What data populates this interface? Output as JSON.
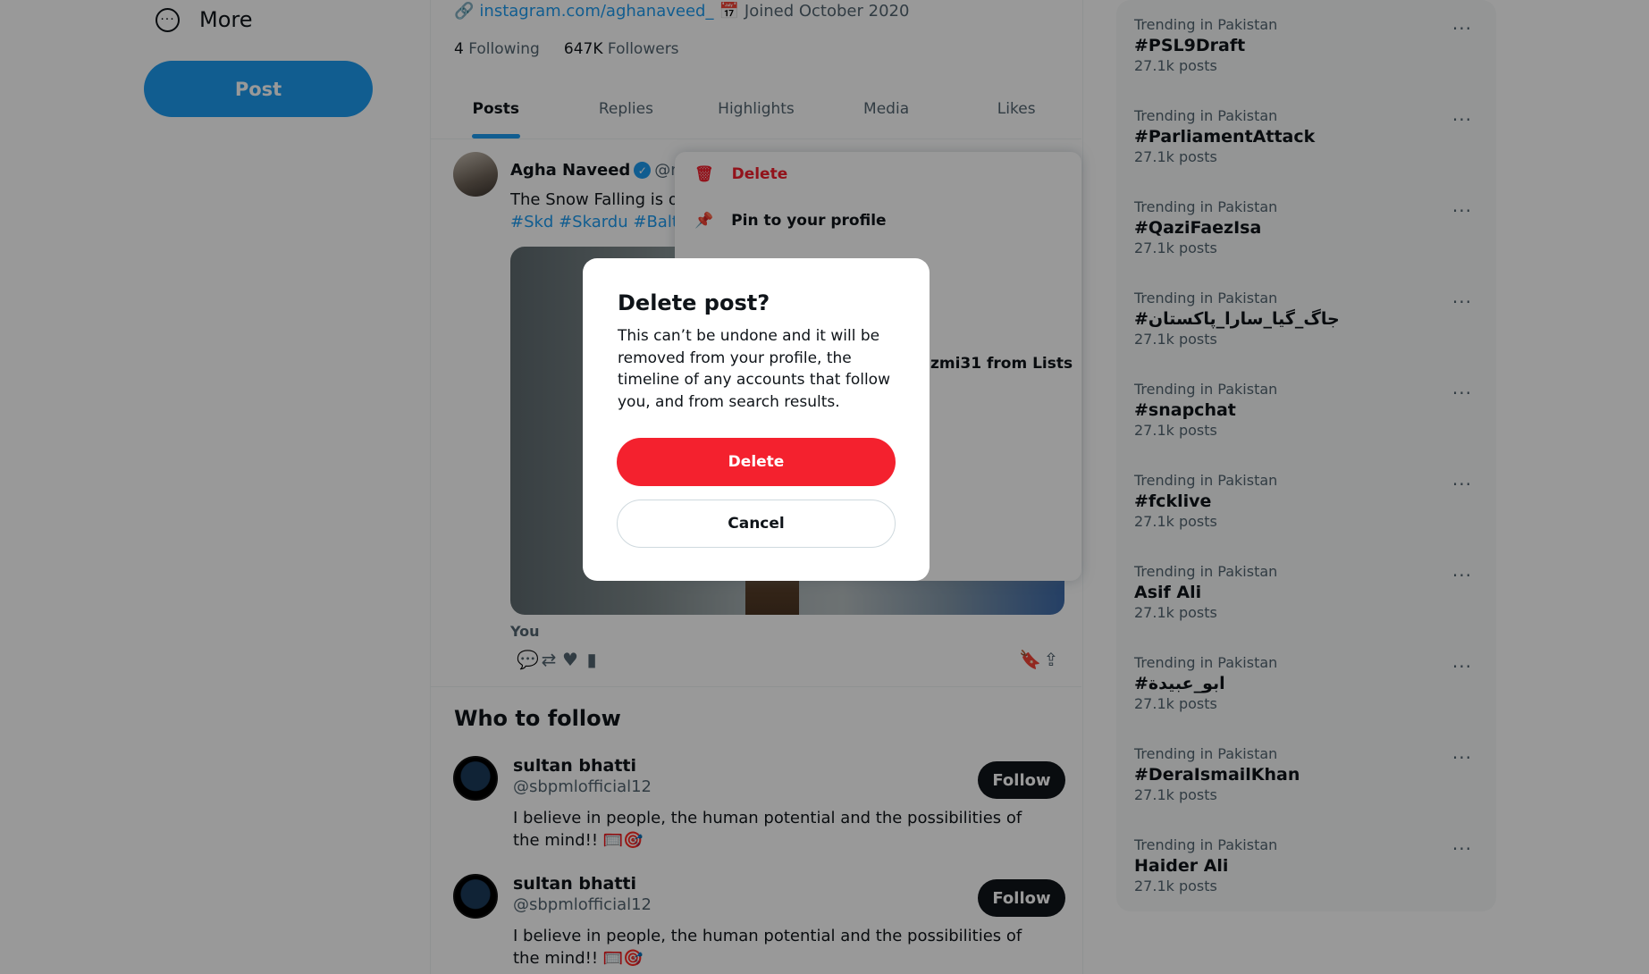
{
  "nav": {
    "more_label": "More",
    "post_label": "Post"
  },
  "profile": {
    "link": "instagram.com/aghanaveed_",
    "joined": "Joined October 2020",
    "following_count": "4",
    "following_label": "Following",
    "followers_count": "647K",
    "followers_label": "Followers"
  },
  "tabs": [
    "Posts",
    "Replies",
    "Highlights",
    "Media",
    "Likes"
  ],
  "tweet": {
    "name": "Agha Naveed",
    "handle": "@na",
    "text": "The Snow Falling is o",
    "tags": "#Skd #Skardu #Balt",
    "you_label": "You"
  },
  "menu": {
    "delete_label": "Delete",
    "pin_label": "Pin to your profile",
    "lists_label": "zmi31 from Lists"
  },
  "who_to_follow": {
    "title": "Who to follow",
    "people": [
      {
        "name": "sultan bhatti",
        "handle": "@sbpmlofficial12",
        "bio": "I believe in people, the human potential and the possibilities of the mind!! 🥅🎯",
        "button": "Follow"
      },
      {
        "name": "sultan bhatti",
        "handle": "@sbpmlofficial12",
        "bio": "I believe in people, the human potential and the possibilities of the mind!! 🥅🎯",
        "button": "Follow"
      }
    ]
  },
  "trends": [
    {
      "category": "Trending in Pakistan",
      "title": "#PSL9Draft",
      "posts": "27.1k posts"
    },
    {
      "category": "Trending in Pakistan",
      "title": "#ParliamentAttack",
      "posts": "27.1k posts"
    },
    {
      "category": "Trending in Pakistan",
      "title": "#QaziFaezIsa",
      "posts": "27.1k posts"
    },
    {
      "category": "Trending in Pakistan",
      "title": "#جاگ_گیا_سارا_پاکستان",
      "posts": "27.1k posts"
    },
    {
      "category": "Trending in Pakistan",
      "title": "#snapchat",
      "posts": "27.1k posts"
    },
    {
      "category": "Trending in Pakistan",
      "title": "#fcklive",
      "posts": "27.1k posts"
    },
    {
      "category": "Trending in Pakistan",
      "title": "Asif Ali",
      "posts": "27.1k posts"
    },
    {
      "category": "Trending in Pakistan",
      "title": "#ابو_عبيدة",
      "posts": "27.1k posts"
    },
    {
      "category": "Trending in Pakistan",
      "title": "#DeraIsmailKhan",
      "posts": "27.1k posts"
    },
    {
      "category": "Trending in Pakistan",
      "title": "Haider Ali",
      "posts": "27.1k posts"
    }
  ],
  "dialog": {
    "title": "Delete post?",
    "body": "This can’t be undone and it will be removed from your profile, the timeline of any accounts that follow you, and from search results.",
    "confirm_label": "Delete",
    "cancel_label": "Cancel"
  },
  "colors": {
    "accent": "#1d9bf0",
    "danger": "#f4212e",
    "text": "#0f1419",
    "muted": "#536471"
  }
}
